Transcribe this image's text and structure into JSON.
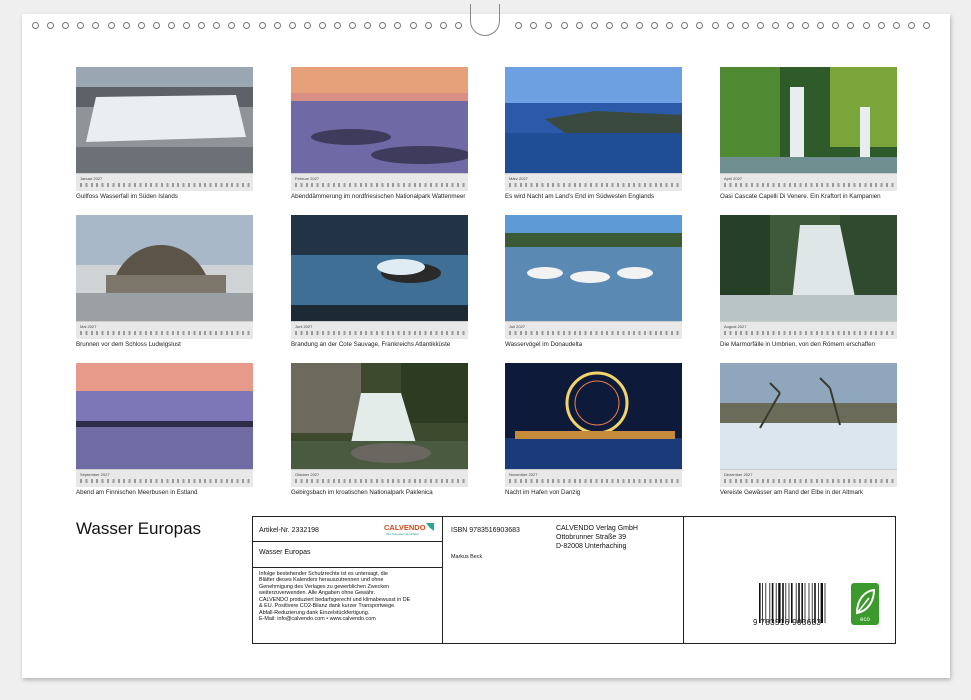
{
  "document": {
    "title": "Wasser Europas"
  },
  "months": [
    {
      "name": "Januar 2027",
      "caption": "Gullfoss Wasserfall im Süden Islands"
    },
    {
      "name": "Februar 2027",
      "caption": "Abenddämmerung im nordfriesischen Nationalpark Wattenmeer"
    },
    {
      "name": "März 2027",
      "caption": "Es wird Nacht am Land's End im Südwesten Englands"
    },
    {
      "name": "April 2027",
      "caption": "Oasi Cascate Capelli Di Venere. Ein Kraftort in Kampanien"
    },
    {
      "name": "Mai 2027",
      "caption": "Brunnen vor dem Schloss Ludwigslust"
    },
    {
      "name": "Juni 2027",
      "caption": "Brandung an der Cote Sauvage, Frankreichs Atlantikküste"
    },
    {
      "name": "Juli 2027",
      "caption": "Wasservögel im Donaudelta"
    },
    {
      "name": "August 2027",
      "caption": "Die Marmorfälle in Umbrien, von den Römern erschaffen"
    },
    {
      "name": "September 2027",
      "caption": "Abend am Finnischen Meerbusen in Estland"
    },
    {
      "name": "Oktober 2027",
      "caption": "Gebirgsbach im kroatischen Nationalpark Paklenica"
    },
    {
      "name": "November 2027",
      "caption": "Nacht im Hafen von Danzig"
    },
    {
      "name": "Dezember 2027",
      "caption": "Vereiste Gewässer am Rand der Elbe in der Altmark"
    }
  ],
  "imprint": {
    "article": "Artikel-Nr. 2332198",
    "product_title": "Wasser Europas",
    "legal_text": [
      "Infolge bestehender Schutzrechte ist es untersagt, die",
      "Blätter dieses Kalenders herauszutrennen und ohne",
      "Genehmigung des Verlages zu gewerblichen Zwecken",
      "weiterzuverwenden. Alle Angaben ohne Gewähr.",
      "CALVENDO produziert bedarfsgerecht und klimabewusst in DE",
      "& EU. Positivere CO2-Bilanz dank kurzer Transportwege.",
      "Abfall-Reduzierung dank Einzelstückfertigung.",
      "E-Mail: info@calvendo.com • www.calvendo.com"
    ],
    "isbn": "ISBN 9783516903683",
    "author": "Markus Beck",
    "publisher": [
      "CALVENDO Verlag GmbH",
      "Ottobrunner Straße 39",
      "D-82008 Unterhaching"
    ],
    "brand": "CALVENDO",
    "barcode_number": "9 783516 903683",
    "eco_label": "eco"
  }
}
